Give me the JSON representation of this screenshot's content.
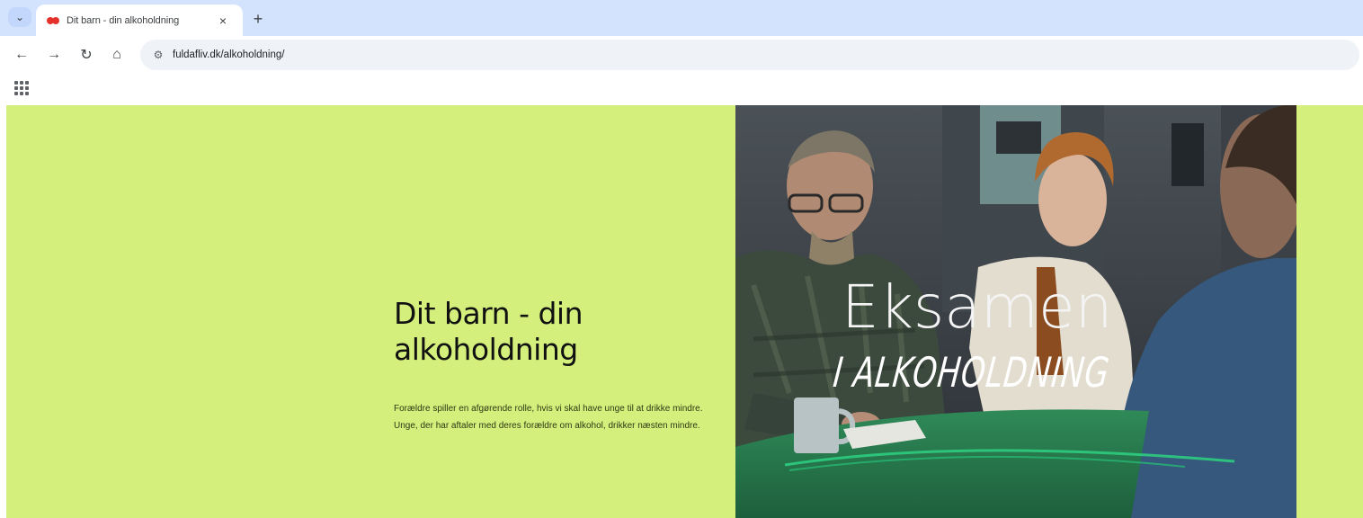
{
  "browser": {
    "tab": {
      "title": "Dit barn - din alkoholdning",
      "close_glyph": "×"
    },
    "new_tab_glyph": "+",
    "nav": {
      "back_glyph": "←",
      "forward_glyph": "→",
      "reload_glyph": "↻",
      "home_glyph": "⌂",
      "tab_menu_glyph": "⌄"
    },
    "address_bar": {
      "site_info_glyph": "⚙",
      "url": "fuldafliv.dk/alkoholdning/"
    }
  },
  "hero": {
    "title": "Dit barn - din alkoholdning",
    "description": "Forældre spiller en afgørende rolle, hvis vi skal have unge til at drikke mindre. Unge, der har aftaler med deres forældre om alkohol, drikker næsten mindre.",
    "image": {
      "overlay_title": "Eksamen",
      "overlay_subtitle": "I ALKOHOLDNING"
    }
  },
  "colors": {
    "page_background": "#d4ef7b",
    "tabstrip": "#d3e3fd",
    "table_green": "#2a7a50",
    "swoosh_green": "#2ecc80"
  }
}
